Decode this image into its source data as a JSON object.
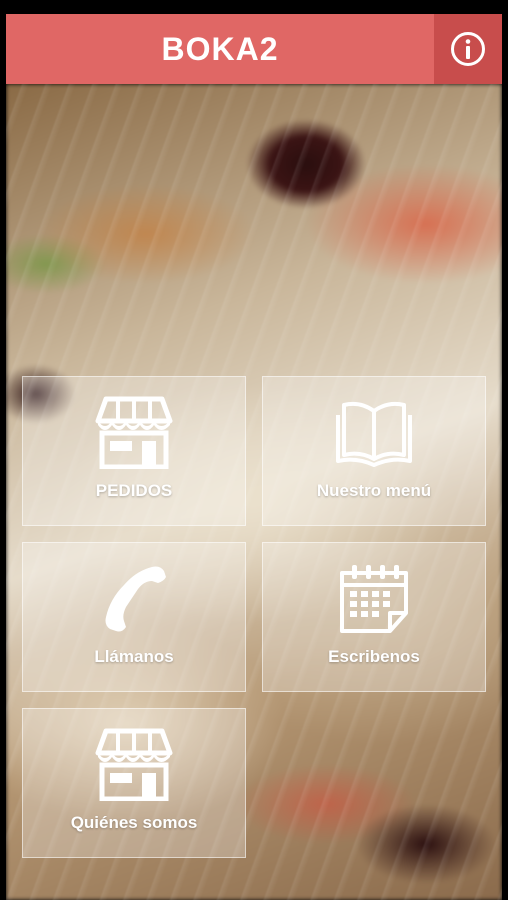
{
  "header": {
    "title": "BOKA2",
    "info_icon": "info-icon",
    "color": "#e06765",
    "info_bg": "#c84d4c"
  },
  "tiles": [
    {
      "label": "PEDIDOS",
      "icon": "store-icon"
    },
    {
      "label": "Nuestro menú",
      "icon": "book-icon"
    },
    {
      "label": "Llámanos",
      "icon": "phone-icon"
    },
    {
      "label": "Escribenos",
      "icon": "calendar-icon"
    },
    {
      "label": "Quiénes somos",
      "icon": "store-icon"
    }
  ]
}
